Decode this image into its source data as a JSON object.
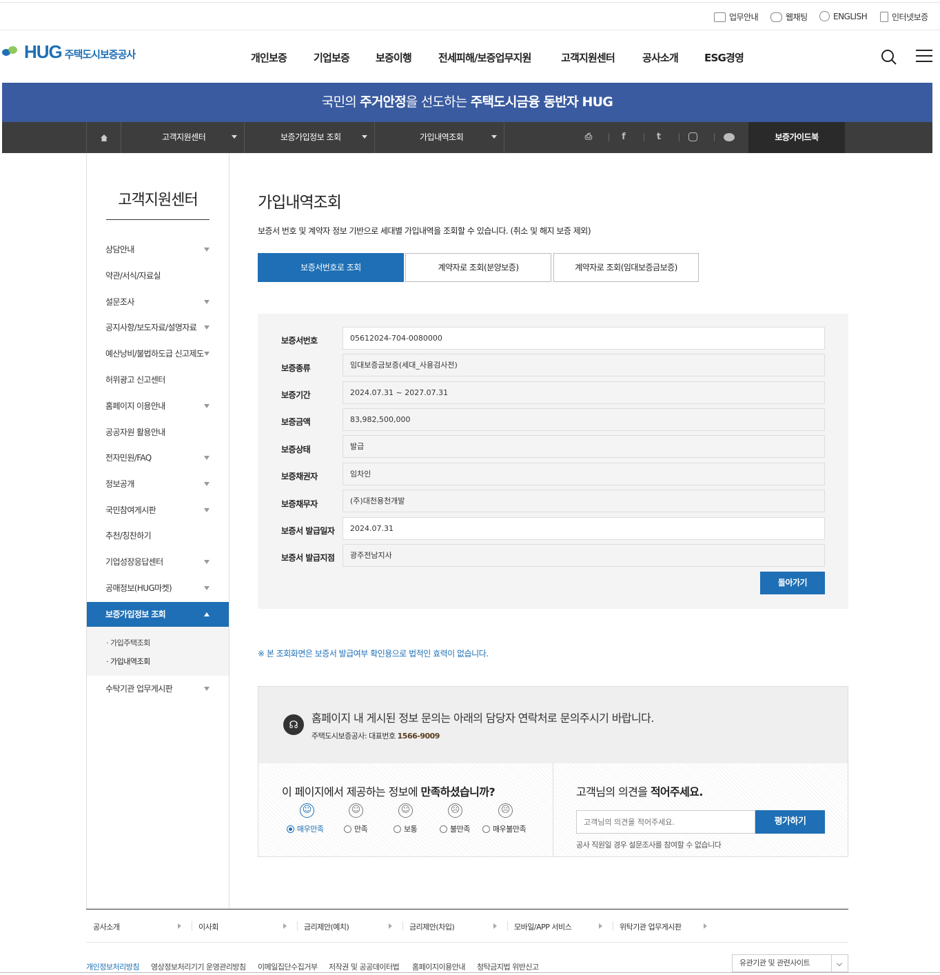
{
  "util": {
    "items": [
      "업무안내",
      "웹채팅",
      "ENGLISH",
      "인터넷보증"
    ]
  },
  "logo": {
    "brand": "HUG",
    "name": "주택도시보증공사"
  },
  "gnb": [
    "개인보증",
    "기업보증",
    "보증이행",
    "전세피해/보증업무지원",
    "고객지원센터",
    "공사소개",
    "ESG경영"
  ],
  "banner": {
    "p1": "국민의 ",
    "b1": "주거안정",
    "p2": "을 선도하는 ",
    "b2": "주택도시금융",
    "p3": " 동반자 HUG"
  },
  "location": {
    "depth1": "고객지원센터",
    "depth2": "보증가입정보 조회",
    "depth3": "가입내역조회",
    "guide": "보증가이드북"
  },
  "lnb": {
    "title": "고객지원센터",
    "items": [
      "상담안내",
      "약관/서식/자료실",
      "설문조사",
      "공지사항/보도자료/설명자료",
      "예산낭비/불법하도급 신고제도",
      "허위광고 신고센터",
      "홈페이지 이용안내",
      "공공자원 활용안내",
      "전자민원/FAQ",
      "정보공개",
      "국민참여게시판",
      "추천/칭찬하기",
      "기업성장응답센터",
      "공매정보(HUG마켓)",
      "보증가입정보 조회",
      "수탁기관 업무게시판"
    ],
    "sub": [
      "가입주택조회",
      "가입내역조회"
    ]
  },
  "page": {
    "title": "가입내역조회",
    "desc": "보증서 번호 및 계약자 정보 기반으로 세대별 가입내역을 조회할 수 있습니다. (취소 및 해지 보증 제외)",
    "tabs": [
      "보증서번호로 조회",
      "계약자로 조회(분양보증)",
      "계약자로 조회(임대보증금보증)"
    ]
  },
  "form": {
    "rows": [
      {
        "label": "보증서번호",
        "value": "05612024-704-0080000"
      },
      {
        "label": "보증종류",
        "value": "임대보증금보증(세대_사용검사전)"
      },
      {
        "label": "보증기간",
        "value": "2024.07.31 ~ 2027.07.31"
      },
      {
        "label": "보증금액",
        "value": "83,982,500,000"
      },
      {
        "label": "보증상태",
        "value": "발급"
      },
      {
        "label": "보증채권자",
        "value": "임차인"
      },
      {
        "label": "보증채무자",
        "value": "(주)대천용천개발"
      },
      {
        "label": "보증서 발급일자",
        "value": "2024.07.31"
      },
      {
        "label": "보증서 발급지점",
        "value": "광주전남지사"
      }
    ],
    "back_label": "돌아가기"
  },
  "notice": "※ 본 조회화면은 보증서 발급여부 확인용으로 법적인 효력이 없습니다.",
  "contact": {
    "message": "홈페이지 내 게시된 정보 문의는 아래의 담당자 연락처로 문의주시기 바랍니다.",
    "sub_prefix": "주택도시보증공사: 대표번호 ",
    "phone": "1566-9009"
  },
  "survey": {
    "q_prefix": "이 페이지에서 제공하는 정보에 ",
    "q_bold": "만족하셨습니까?",
    "options": [
      "매우만족",
      "만족",
      "보통",
      "불만족",
      "매우불만족"
    ],
    "selected": "매우만족"
  },
  "opinion": {
    "q_prefix": "고객님의 의견을 ",
    "q_bold": "적어주세요.",
    "placeholder": "고객님의 의견을 적어주세요.",
    "button": "평가하기",
    "note": "공사 직원일 경우 설문조사를 참여할 수 없습니다"
  },
  "footer": {
    "links": [
      "공사소개",
      "이사회",
      "금리제안(예치)",
      "금리제안(차입)",
      "모바일/APP 서비스",
      "위탁기관 업무게시판"
    ],
    "policies": [
      "개인정보처리방침",
      "영상정보처리기기 운영관리방침",
      "이메일집단수집거부",
      "저작권 및 공공데이터법",
      "홈페이지이용안내",
      "청탁금지법 위반신고"
    ],
    "related": "유관기관 및 관련사이트"
  },
  "colors": {
    "primary": "#1e6fb5",
    "banner": "#3a5ba0",
    "location_bar": "#3d3d3d"
  }
}
